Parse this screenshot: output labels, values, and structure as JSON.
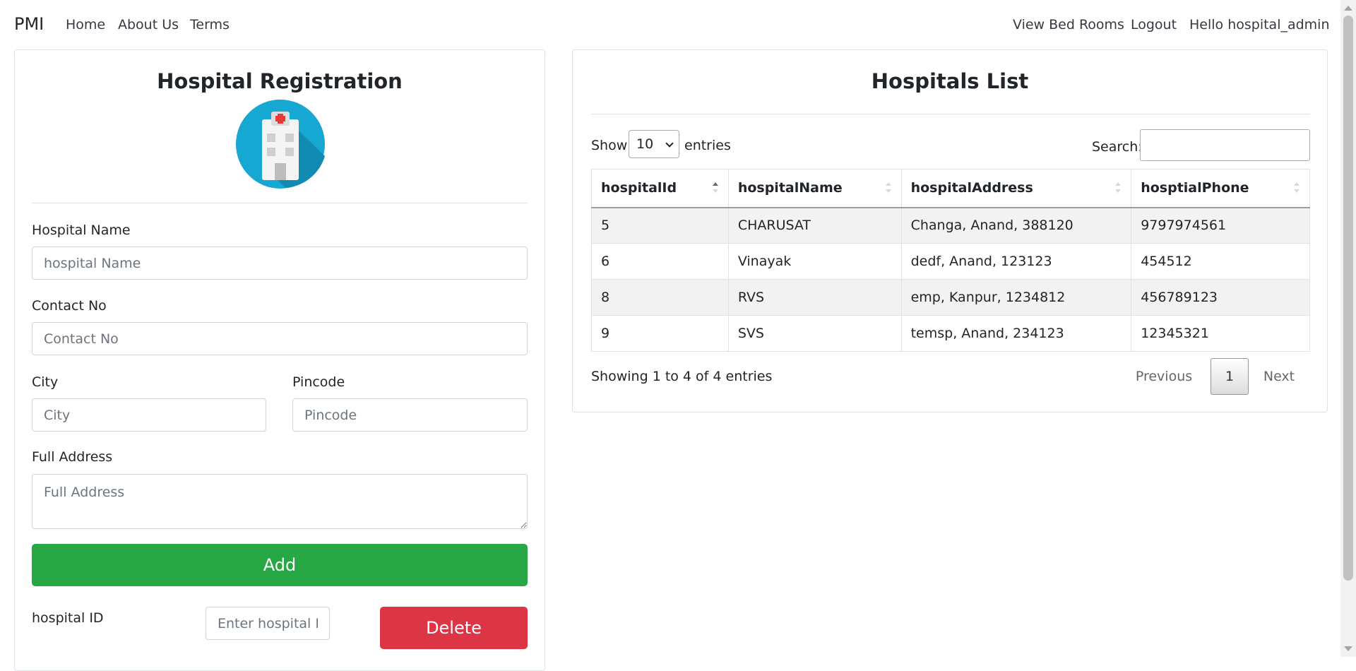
{
  "nav": {
    "brand": "PMI",
    "left_links": [
      "Home",
      "About Us",
      "Terms"
    ],
    "right_links": [
      "View Bed Rooms",
      "Logout",
      "Hello hospital_admin"
    ]
  },
  "registration": {
    "title": "Hospital Registration",
    "logo_icon": "hospital-building-icon",
    "hospital_name_label": "Hospital Name",
    "hospital_name_placeholder": "hospital Name",
    "contact_label": "Contact No",
    "contact_placeholder": "Contact No",
    "city_label": "City",
    "city_placeholder": "City",
    "pincode_label": "Pincode",
    "pincode_placeholder": "Pincode",
    "address_label": "Full Address",
    "address_placeholder": "Full Address",
    "add_label": "Add",
    "hospital_id_label": "hospital ID",
    "hospital_id_placeholder": "Enter hospital ID",
    "delete_label": "Delete",
    "colors": {
      "add": "#28a745",
      "delete": "#dc3545"
    }
  },
  "list": {
    "title": "Hospitals List",
    "show_label": "Show",
    "entries_value": "10",
    "entries_label": "entries",
    "search_label": "Search:",
    "columns": [
      "hospitalId",
      "hospitalName",
      "hospitalAddress",
      "hosptialPhone"
    ],
    "rows": [
      [
        "5",
        "CHARUSAT",
        "Changa, Anand, 388120",
        "9797974561"
      ],
      [
        "6",
        "Vinayak",
        "dedf, Anand, 123123",
        "454512"
      ],
      [
        "8",
        "RVS",
        "emp, Kanpur, 1234812",
        "456789123"
      ],
      [
        "9",
        "SVS",
        "temsp, Anand, 234123",
        "12345321"
      ]
    ],
    "info": "Showing 1 to 4 of 4 entries",
    "pagination": {
      "previous": "Previous",
      "current": "1",
      "next": "Next"
    }
  }
}
